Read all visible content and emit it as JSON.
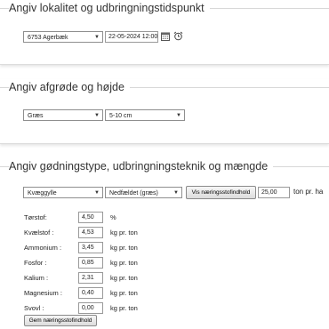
{
  "section1": {
    "title": "Angiv lokalitet og udbringningstidspunkt",
    "location_select": "6753 Agerbæk",
    "date_value": "22-05-2024 12:00"
  },
  "section2": {
    "title": "Angiv afgrøde og højde",
    "crop_select": "Græs",
    "height_select": "5-10 cm"
  },
  "section3": {
    "title": "Angiv gødningstype, udbringningsteknik og mængde",
    "fertilizer_select": "Kvæggylle",
    "technique_select": "Nedfældet (græs)",
    "show_nutrients_button": "Vis næringsstofindhold",
    "amount_value": "25,00",
    "amount_unit": "ton pr. ha",
    "rows": [
      {
        "label": "Tørstof:",
        "value": "4,50",
        "unit": "%"
      },
      {
        "label": "Kvælstof :",
        "value": "4,53",
        "unit": "kg pr. ton"
      },
      {
        "label": "Ammonium :",
        "value": "3,45",
        "unit": "kg pr. ton"
      },
      {
        "label": "Fosfor :",
        "value": "0,85",
        "unit": "kg pr. ton"
      },
      {
        "label": "Kalium :",
        "value": "2,31",
        "unit": "kg pr. ton"
      },
      {
        "label": "Magnesium :",
        "value": "0,40",
        "unit": "kg pr. ton"
      },
      {
        "label": "Svovl :",
        "value": "0,00",
        "unit": "kg pr. ton"
      }
    ],
    "save_button": "Gem næringsstofindhold"
  }
}
